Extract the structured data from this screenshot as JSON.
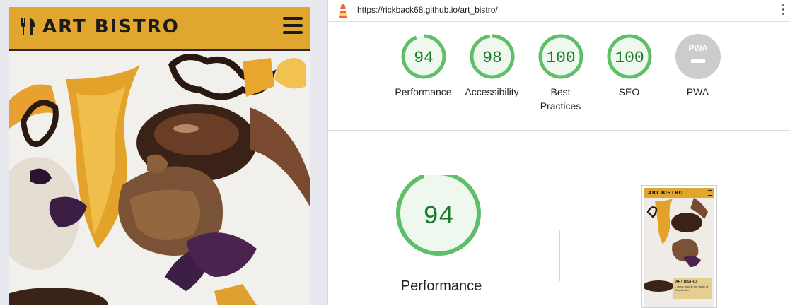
{
  "mobile_preview": {
    "site_title": "ART BISTRO"
  },
  "report": {
    "url": "https://rickback68.github.io/art_bistro/",
    "gauges": [
      {
        "label": "Performance",
        "score": "94",
        "value": 94
      },
      {
        "label": "Accessibility",
        "score": "98",
        "value": 98
      },
      {
        "label": "Best Practices",
        "score": "100",
        "value": 100
      },
      {
        "label": "SEO",
        "score": "100",
        "value": 100
      },
      {
        "label": "PWA",
        "score": "",
        "value": null
      }
    ],
    "pwa_badge": "PWA",
    "main_score": "94",
    "main_label": "Performance",
    "thumbnail": {
      "site_title": "ART BISTRO",
      "card_title": "ART BISTRO",
      "card_text": "- great food in the heart of Stockholm"
    }
  },
  "colors": {
    "brand_gold": "#e0a630",
    "pass_green": "#0cce6b",
    "score_text": "#0b7a1f",
    "pwa_gray": "#cccccc"
  }
}
